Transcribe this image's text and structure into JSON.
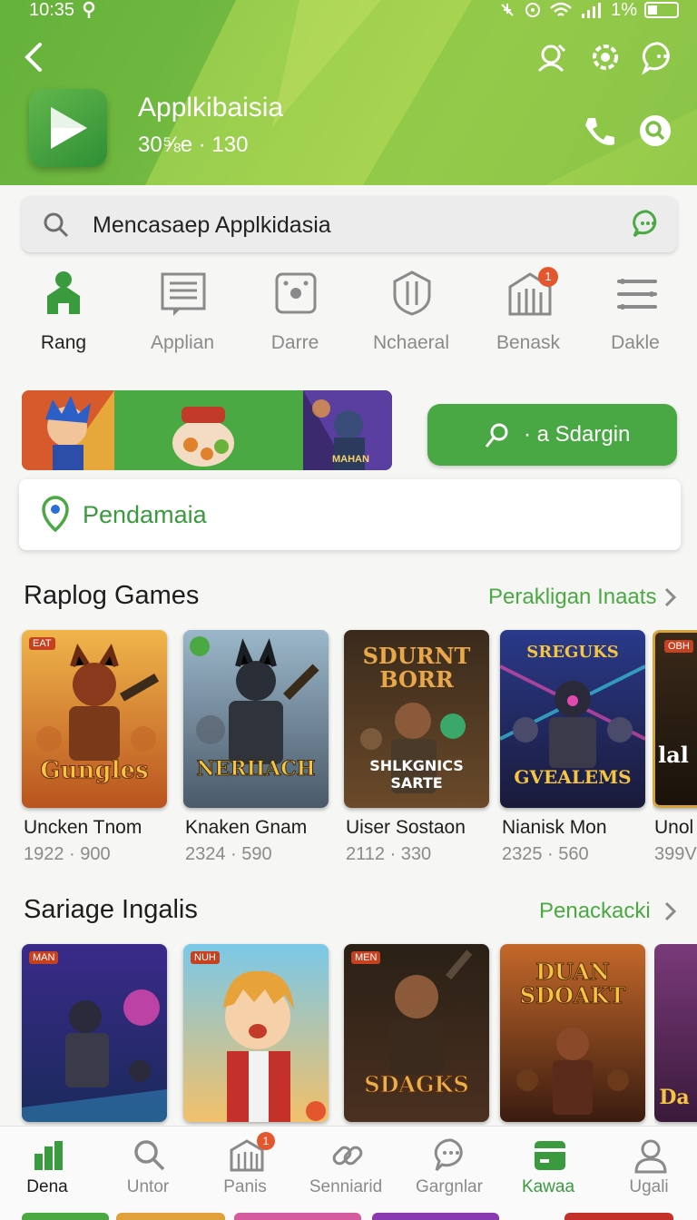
{
  "status": {
    "time": "10:35",
    "battery": "1%"
  },
  "app": {
    "title": "Applkibaisia",
    "subtitle": "30⅝e · 130"
  },
  "search": {
    "query": "Mencasaep Applkidasia"
  },
  "categories": [
    {
      "label": "Rang",
      "icon": "home-icon",
      "active": true
    },
    {
      "label": "Applian",
      "icon": "list-icon"
    },
    {
      "label": "Darre",
      "icon": "dice-icon"
    },
    {
      "label": "Nchaeral",
      "icon": "shield-icon"
    },
    {
      "label": "Benask",
      "icon": "building-icon",
      "badge": "1"
    },
    {
      "label": "Dakle",
      "icon": "menu-icon"
    }
  ],
  "promo": {
    "button_label": "· a Sdargin",
    "banner_caption": "MAHAN",
    "location_label": "Pendamaia"
  },
  "section1": {
    "title": "Raplog Games",
    "link": "Perakligan Inaats",
    "cards": [
      {
        "cover_text": "Gungles",
        "tag": "EAT",
        "name": "Uncken Tnom",
        "meta": "1922 · 900"
      },
      {
        "cover_text": "NERIIACH",
        "tag": "",
        "name": "Knaken Gnam",
        "meta": "2324 · 590"
      },
      {
        "cover_text": "SDURNT BORR",
        "cover_text2": "SHLKGNICS SARTE",
        "tag": "",
        "name": "Uiser Sostaon",
        "meta": "2112 · 330"
      },
      {
        "cover_text": "GVEALEMS",
        "cover_text_top": "SREGUKS",
        "tag": "",
        "name": "Nianisk Mon",
        "meta": "2325 · 560"
      },
      {
        "cover_text": "lal",
        "tag": "OBH",
        "name": "Unol",
        "meta": "399V"
      }
    ]
  },
  "section2": {
    "title": "Sariage Ingalis",
    "link": "Penackacki",
    "cards": [
      {
        "cover_text": "",
        "tag": "MAN"
      },
      {
        "cover_text": "",
        "tag": "NUH"
      },
      {
        "cover_text": "SDAGKS",
        "tag": "MEN"
      },
      {
        "cover_text": "DUAN SDOAKT",
        "tag": ""
      },
      {
        "cover_text": "Da",
        "tag": ""
      }
    ]
  },
  "bottom_nav": [
    {
      "label": "Dena",
      "icon": "chart-icon",
      "active": true
    },
    {
      "label": "Untor",
      "icon": "search-icon"
    },
    {
      "label": "Panis",
      "icon": "building-icon",
      "badge": "1"
    },
    {
      "label": "Senniarid",
      "icon": "link-icon"
    },
    {
      "label": "Gargnlar",
      "icon": "chat-icon"
    },
    {
      "label": "Kawaa",
      "icon": "wallet-icon",
      "green": true
    },
    {
      "label": "Ugali",
      "icon": "user-icon"
    }
  ],
  "colors": {
    "brand_green": "#4aa943",
    "header_green": "#8cc84a",
    "badge": "#e4572e"
  }
}
